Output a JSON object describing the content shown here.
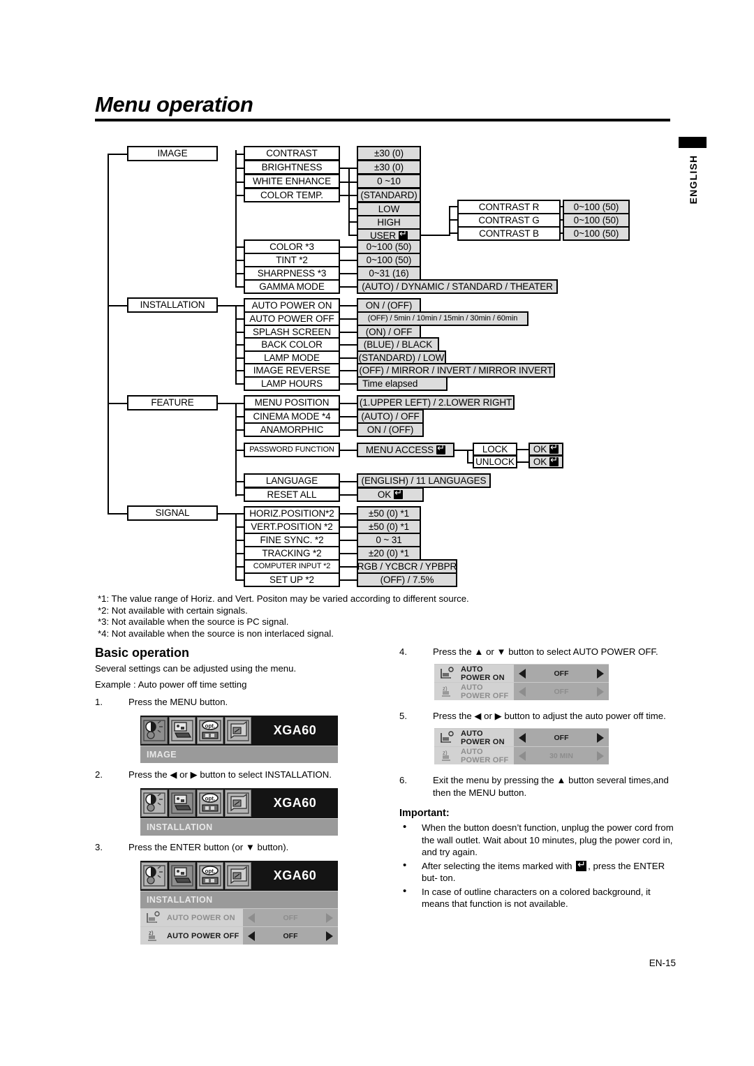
{
  "page": {
    "title": "Menu operation",
    "side_tab_label": "ENGLISH",
    "page_number": "EN-15"
  },
  "tree": {
    "roots": [
      {
        "label": "IMAGE"
      },
      {
        "label": "INSTALLATION"
      },
      {
        "label": "FEATURE"
      },
      {
        "label": "SIGNAL"
      }
    ],
    "image_items": [
      {
        "label": "CONTRAST",
        "value": "±30 (0)"
      },
      {
        "label": "BRIGHTNESS",
        "value": "±30 (0)"
      },
      {
        "label": "WHITE ENHANCE",
        "value": "0 ~10"
      },
      {
        "label": "COLOR TEMP.",
        "value": "(STANDARD)"
      },
      {
        "label": "COLOR  *3",
        "value": "0~100 (50)"
      },
      {
        "label": "TINT     *2",
        "value": "0~100 (50)"
      },
      {
        "label": "SHARPNESS *3",
        "value": "0~31 (16)"
      },
      {
        "label": "GAMMA MODE",
        "value": "(AUTO) / DYNAMIC / STANDARD / THEATER"
      }
    ],
    "color_temp_values": [
      "(STANDARD)",
      "LOW",
      "HIGH",
      "USER"
    ],
    "user_children": [
      {
        "label": "CONTRAST R",
        "value": "0~100 (50)"
      },
      {
        "label": "CONTRAST G",
        "value": "0~100 (50)"
      },
      {
        "label": "CONTRAST B",
        "value": "0~100 (50)"
      }
    ],
    "installation_items": [
      {
        "label": "AUTO POWER ON",
        "value": "ON / (OFF)"
      },
      {
        "label": "AUTO POWER OFF",
        "value": "(OFF) / 5min / 10min / 15min / 30min / 60min"
      },
      {
        "label": "SPLASH SCREEN",
        "value": "(ON) / OFF"
      },
      {
        "label": "BACK COLOR",
        "value": "(BLUE) / BLACK"
      },
      {
        "label": "LAMP MODE",
        "value": "(STANDARD) / LOW"
      },
      {
        "label": "IMAGE REVERSE",
        "value": "(OFF) / MIRROR / INVERT / MIRROR INVERT"
      },
      {
        "label": "LAMP HOURS",
        "value": "Time elapsed"
      }
    ],
    "feature_items": [
      {
        "label": "MENU POSITION",
        "value": "(1.UPPER LEFT) / 2.LOWER RIGHT"
      },
      {
        "label": "CINEMA MODE *4",
        "value": "(AUTO) / OFF"
      },
      {
        "label": "ANAMORPHIC",
        "value": "ON / (OFF)"
      },
      {
        "label": "PASSWORD FUNCTION",
        "value": "MENU ACCESS"
      },
      {
        "label": "LANGUAGE",
        "value": "(ENGLISH) / 11 LANGUAGES"
      },
      {
        "label": "RESET ALL",
        "value": "OK"
      }
    ],
    "password_children": [
      {
        "label": "LOCK",
        "value": "OK"
      },
      {
        "label": "UNLOCK",
        "value": "OK"
      }
    ],
    "signal_items": [
      {
        "label": "HORIZ.POSITION*2",
        "value": "±50 (0)  *1"
      },
      {
        "label": "VERT.POSITION *2",
        "value": "±50 (0)  *1"
      },
      {
        "label": "FINE SYNC. *2",
        "value": "0 ~ 31"
      },
      {
        "label": "TRACKING *2",
        "value": "±20 (0)  *1"
      },
      {
        "label": "COMPUTER INPUT *2",
        "value": "RGB / YCBCR / YPBPR"
      },
      {
        "label": "SET UP *2",
        "value": "(OFF) / 7.5%"
      }
    ]
  },
  "footnotes": [
    "*1: The value range of Horiz. and Vert. Positon may be varied according to different source.",
    "*2: Not available with certain signals.",
    "*3: Not available when the source is PC signal.",
    "*4: Not available when the source is non interlaced signal."
  ],
  "basic_operation": {
    "heading": "Basic operation",
    "intro": "Several settings can be adjusted using the menu.",
    "example": "Example : Auto power off time setting",
    "steps": [
      {
        "num": "1.",
        "text": "Press the MENU button."
      },
      {
        "num": "2.",
        "text": "Press the ◀ or ▶ button to select INSTALLATION."
      },
      {
        "num": "3.",
        "text": "Press the ENTER button (or ▼ button)."
      },
      {
        "num": "4.",
        "text": "Press the ▲ or ▼ button to select AUTO POWER OFF."
      },
      {
        "num": "5.",
        "text": "Press the ◀ or ▶ button to adjust the auto power off time."
      },
      {
        "num": "6.",
        "text": "Exit the menu by pressing the ▲ button several times,and then the MENU button."
      }
    ]
  },
  "osd": {
    "signal_label": "XGA60",
    "tabs": [
      "image-tab-icon",
      "installation-tab-icon",
      "option-tab-icon",
      "signal-tab-icon"
    ],
    "screens": [
      {
        "id": "osd-image",
        "category": "IMAGE",
        "active_tab": 0,
        "rows": []
      },
      {
        "id": "osd-installation",
        "category": "INSTALLATION",
        "active_tab": 1,
        "rows": []
      },
      {
        "id": "osd-installation-rows",
        "category": "INSTALLATION",
        "active_tab": 1,
        "rows": [
          {
            "icon": "auto-power-on-icon",
            "label": "AUTO POWER ON",
            "value": "OFF",
            "dim": true
          },
          {
            "icon": "auto-power-off-icon",
            "label": "AUTO POWER OFF",
            "value": "OFF",
            "dim": false
          }
        ]
      },
      {
        "id": "osd-step4",
        "rows": [
          {
            "icon": "auto-power-on-icon",
            "label": "AUTO POWER ON",
            "value": "OFF",
            "dim": false
          },
          {
            "icon": "auto-power-off-icon",
            "label": "AUTO POWER OFF",
            "value": "OFF",
            "dim": true
          }
        ]
      },
      {
        "id": "osd-step5",
        "rows": [
          {
            "icon": "auto-power-on-icon",
            "label": "AUTO POWER ON",
            "value": "OFF",
            "dim": false
          },
          {
            "icon": "auto-power-off-icon",
            "label": "AUTO POWER OFF",
            "value": "30 MIN",
            "dim": true
          }
        ]
      }
    ]
  },
  "important": {
    "heading": "Important:",
    "bullets": [
      "When the button doesn’t function, unplug the power cord from the wall outlet. Wait about 10 minutes, plug the power cord in, and try again.",
      "After selecting the items marked with  , press the ENTER button.",
      "In case of outline characters on a colored background, it means that function is not available."
    ],
    "bullet2_pre": "After selecting the items marked with",
    "bullet2_post": ", press the ENTER but-",
    "bullet2_tail": "ton."
  }
}
